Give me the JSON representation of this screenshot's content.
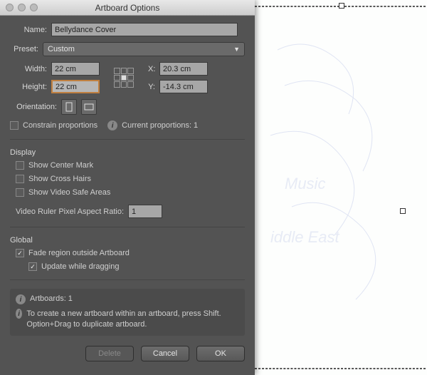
{
  "dialog": {
    "title": "Artboard Options",
    "nameLabel": "Name:",
    "nameValue": "Bellydance Cover",
    "presetLabel": "Preset:",
    "presetValue": "Custom",
    "widthLabel": "Width:",
    "widthValue": "22 cm",
    "heightLabel": "Height:",
    "heightValue": "22 cm",
    "xLabel": "X:",
    "xValue": "20.3 cm",
    "yLabel": "Y:",
    "yValue": "-14.3 cm",
    "orientationLabel": "Orientation:",
    "constrainLabel": "Constrain proportions",
    "currentPropLabel": "Current proportions: 1",
    "displayTitle": "Display",
    "showCenter": "Show Center Mark",
    "showCross": "Show Cross Hairs",
    "showVideo": "Show Video Safe Areas",
    "ratioLabel": "Video Ruler Pixel Aspect Ratio:",
    "ratioValue": "1",
    "globalTitle": "Global",
    "fadeLabel": "Fade region outside Artboard",
    "updateLabel": "Update while dragging",
    "artboardsLabel": "Artboards: 1",
    "hintText": "To create a new artboard within an artboard, press Shift. Option+Drag to duplicate artboard.",
    "deleteBtn": "Delete",
    "cancelBtn": "Cancel",
    "okBtn": "OK"
  },
  "canvas": {
    "text1": "Music",
    "text2": "iddle East"
  }
}
